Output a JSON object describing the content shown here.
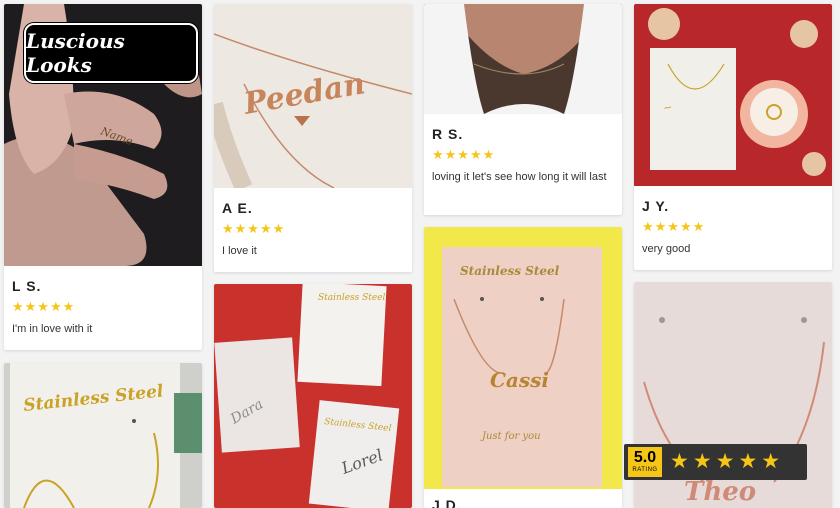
{
  "brand": {
    "logo_text": "Luscious Looks"
  },
  "reviews": [
    {
      "name": "L S.",
      "stars": "★★★★★",
      "text": "I'm in love with it"
    },
    {
      "name": "A E.",
      "stars": "★★★★★",
      "text": "I love it"
    },
    {
      "name": "R S.",
      "stars": "★★★★★",
      "text": "loving it let's see how long it will last"
    },
    {
      "name": "J Y.",
      "stars": "★★★★★",
      "text": "very good"
    },
    {
      "name": "J D."
    }
  ],
  "photos": {
    "p1": {
      "script": "Name"
    },
    "p2": {
      "script": "Peedan"
    },
    "p5": {
      "label": "Stainless Steel",
      "script": "Cassi",
      "tag": "Just for you"
    },
    "p6": {
      "label": "Stainless Steel"
    },
    "p7": {
      "label": "Stainless Steel",
      "script1": "Dara",
      "script2": "Lorel"
    },
    "p8": {
      "script": "Theo"
    }
  },
  "rating_badge": {
    "value": "5.0",
    "label": "RATING",
    "stars": "★★★★★"
  },
  "colors": {
    "star": "#f5c518",
    "badge_bg": "#333333"
  }
}
